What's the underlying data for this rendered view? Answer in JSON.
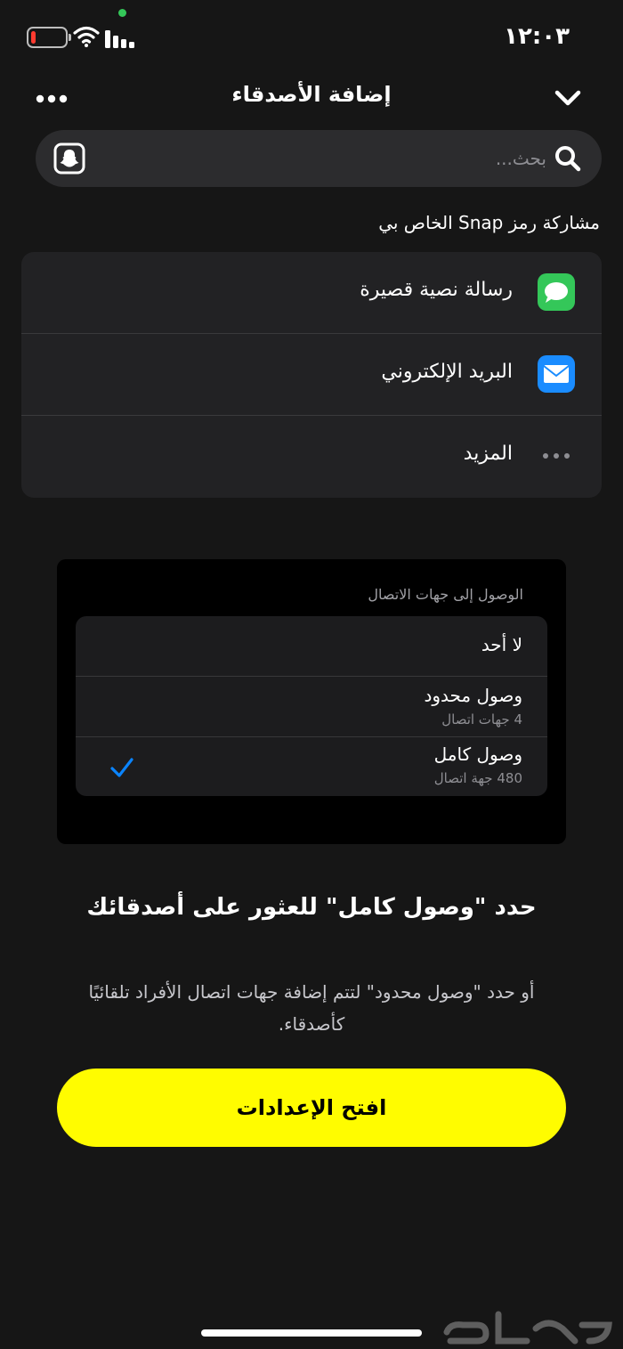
{
  "status_bar": {
    "time": "١٢:٠٣",
    "battery_level": 0.12
  },
  "header": {
    "title": "إضافة الأصدقاء"
  },
  "search": {
    "placeholder": "بحث..."
  },
  "share": {
    "label": "مشاركة رمز Snap الخاص بي",
    "items": [
      {
        "label": "رسالة نصية قصيرة",
        "icon": "messages-icon"
      },
      {
        "label": "البريد الإلكتروني",
        "icon": "mail-icon"
      },
      {
        "label": "المزيد",
        "icon": "more-dots-icon"
      }
    ]
  },
  "contacts_access": {
    "title": "الوصول إلى جهات الاتصال",
    "options": [
      {
        "label": "لا أحد",
        "sub": ""
      },
      {
        "label": "وصول محدود",
        "sub": "4 جهات اتصال"
      },
      {
        "label": "وصول كامل",
        "sub": "480 جهة اتصال",
        "selected": true
      }
    ]
  },
  "prompt": {
    "headline": "حدد \"وصول كامل\" للعثور على أصدقائك",
    "subtext": "أو حدد \"وصول محدود\" لتتم إضافة جهات اتصال الأفراد تلقائيًا كأصدقاء."
  },
  "cta": {
    "label": "افتح الإعدادات"
  },
  "colors": {
    "accent": "#fffc00",
    "background": "#161616",
    "check": "#0a84ff"
  }
}
